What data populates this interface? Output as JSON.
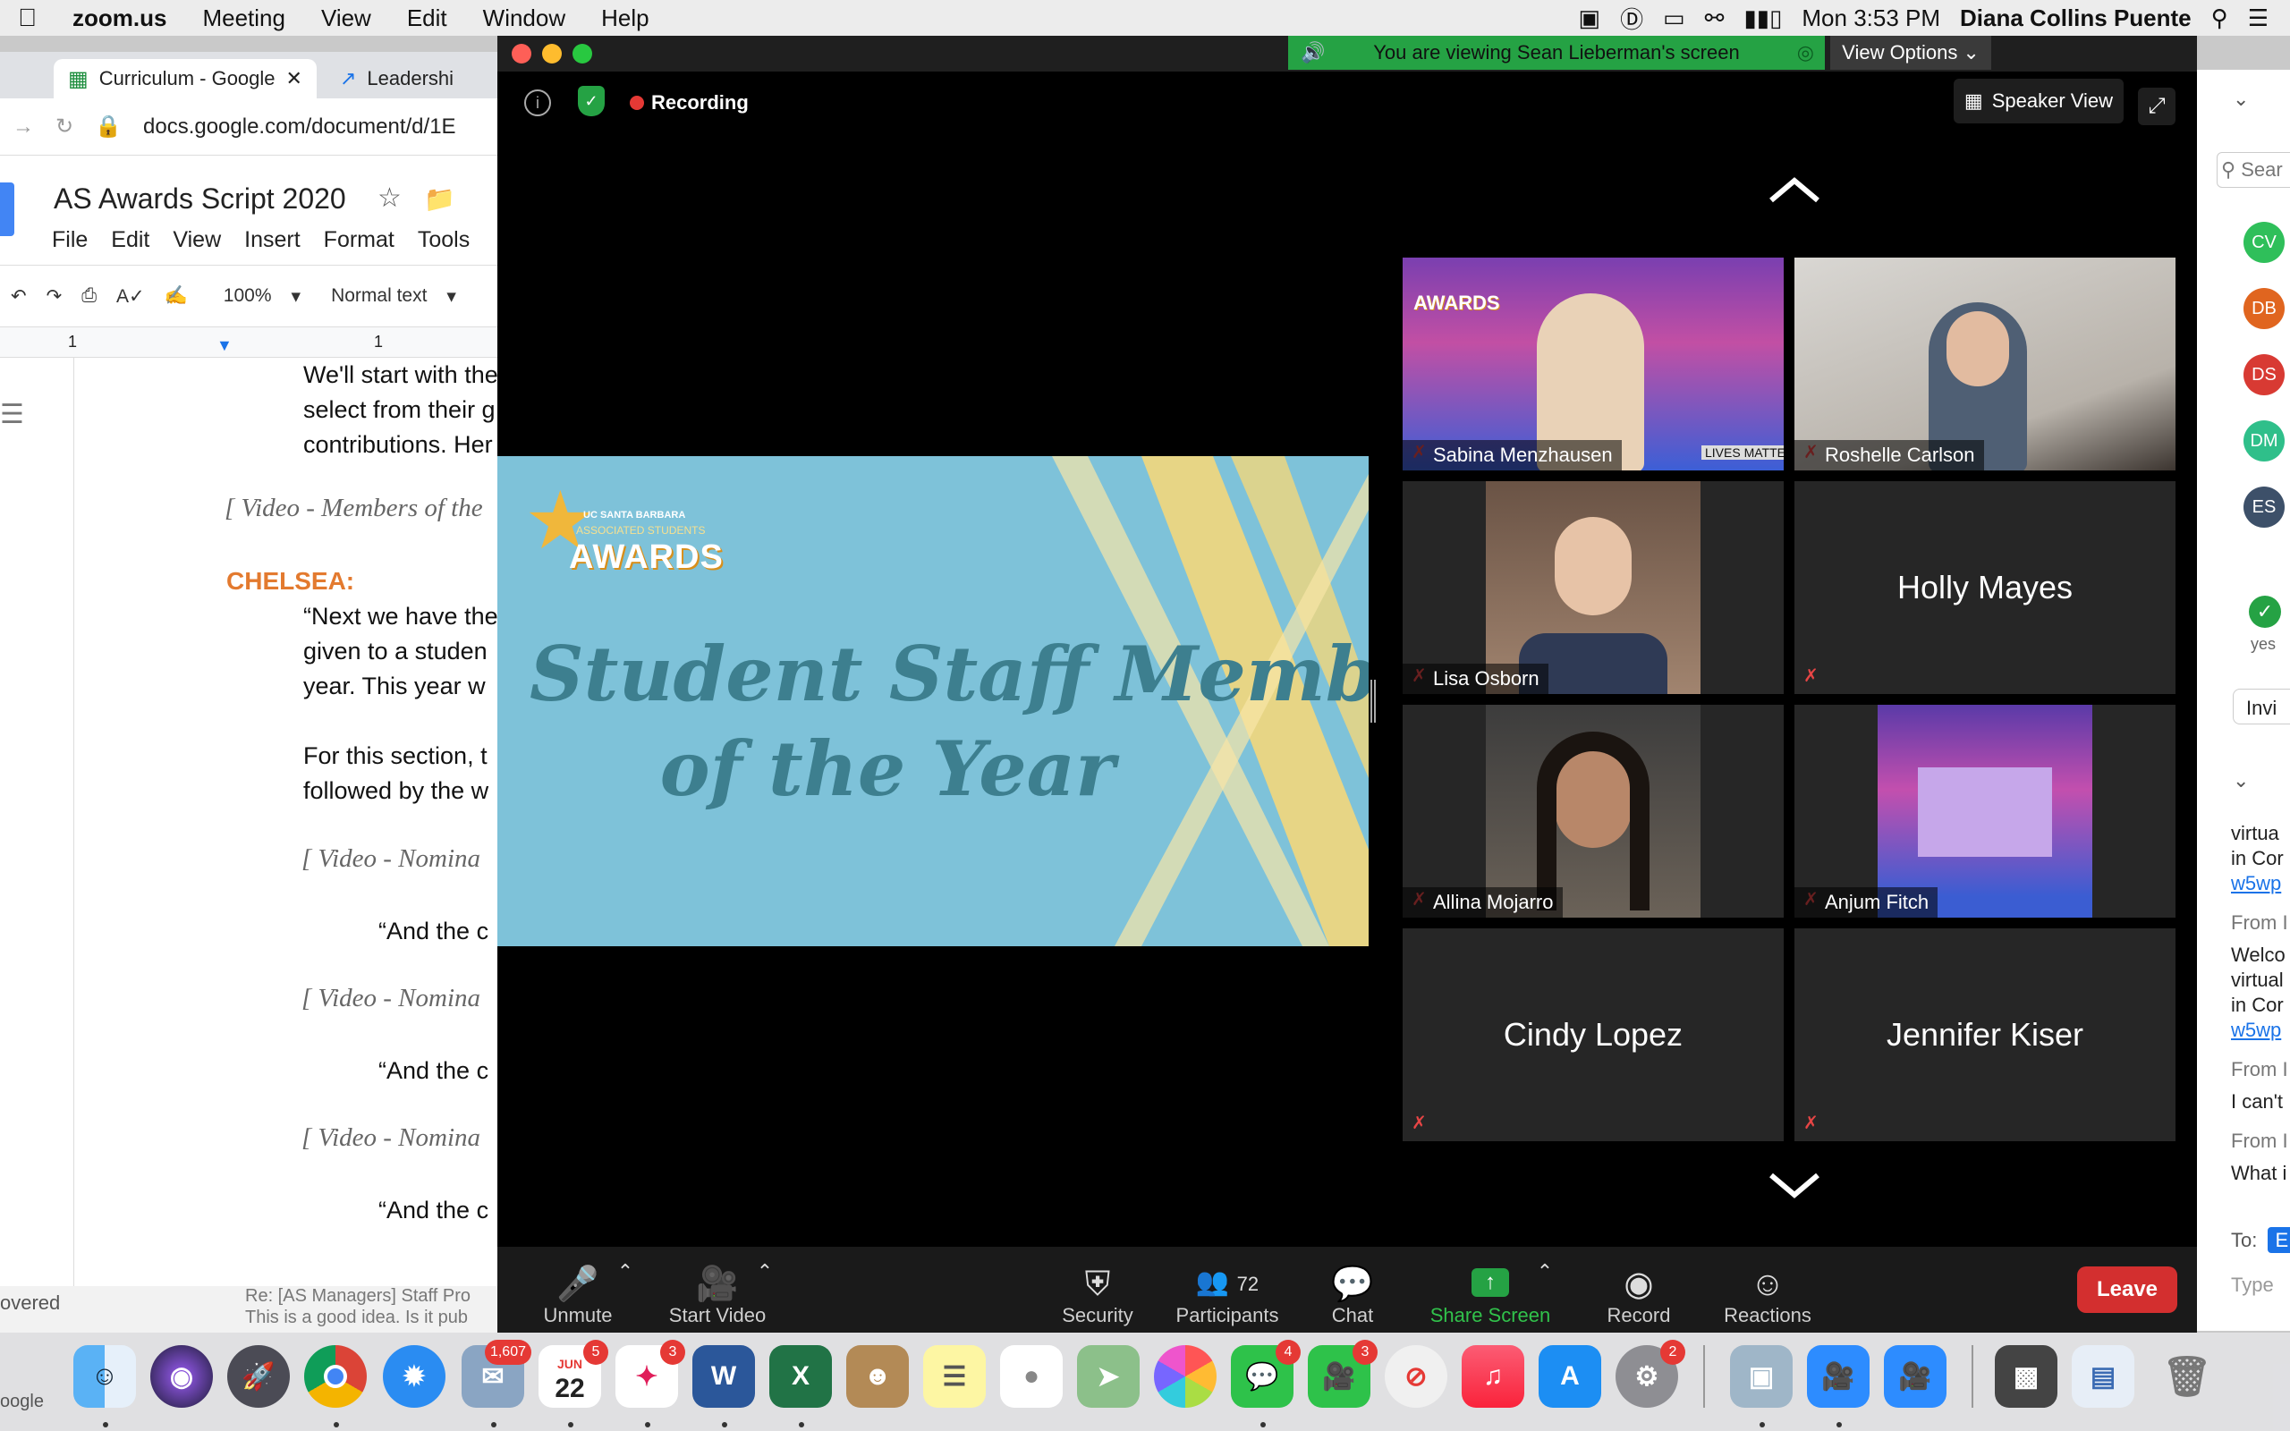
{
  "menubar": {
    "apple": "",
    "app": "zoom.us",
    "items": [
      "Meeting",
      "View",
      "Edit",
      "Window",
      "Help"
    ],
    "clock": "Mon 3:53 PM",
    "user": "Diana Collins Puente"
  },
  "browser": {
    "tabs": [
      "Curriculum - Google",
      "Leadershi"
    ],
    "url": "docs.google.com/document/d/1E"
  },
  "gdocs": {
    "title": "AS Awards Script 2020",
    "menu": [
      "File",
      "Edit",
      "View",
      "Insert",
      "Format",
      "Tools"
    ],
    "zoom": "100%",
    "style": "Normal text",
    "ruler_left": "1",
    "ruler_mid": "1",
    "lines": {
      "l1": "We'll start with the",
      "l2": "select from their g",
      "l3": "contributions. Her",
      "video1": "[ Video - Members of the",
      "speaker": "CHELSEA:",
      "l4": "“Next we have the",
      "l5": "given to a studen",
      "l6": "year. This year w",
      "l7": "For this section, t",
      "l8": "followed by the w",
      "video2": "[ Video - Nomina",
      "q1": "“And the c",
      "video3": "[ Video - Nomina",
      "q2": "“And the c",
      "video4": "[ Video - Nomina",
      "q3": "“And the c"
    },
    "email_snippet_1": "Re: [AS Managers] Staff Pro",
    "email_snippet_2": "This is a good idea. Is it pub",
    "left_edge_1": "overed",
    "left_edge_2": "oogle"
  },
  "zoom": {
    "viewing_banner": "You are viewing Sean Lieberman's screen",
    "view_options": "View Options",
    "recording": "Recording",
    "speaker_view": "Speaker View",
    "shared_slide": {
      "logo_small": "UC SANTA BARBARA",
      "logo_sub": "ASSOCIATED STUDENTS",
      "logo_main": "AWARDS",
      "title_line1": "Student Staff Member",
      "title_line2": "of the Year"
    },
    "participants": [
      {
        "name": "Sabina Menzhausen",
        "video": true
      },
      {
        "name": "Roshelle Carlson",
        "video": true
      },
      {
        "name": "Lisa Osborn",
        "video": true
      },
      {
        "name": "Holly Mayes",
        "video": false
      },
      {
        "name": "Allina Mojarro",
        "video": true
      },
      {
        "name": "Anjum Fitch",
        "video": true
      },
      {
        "name": "Cindy Lopez",
        "video": false
      },
      {
        "name": "Jennifer Kiser",
        "video": false
      }
    ],
    "tile_text_sabina_bg": "AWARDS",
    "tile_text_sabina_tag": "LIVES MATTER",
    "toolbar": {
      "unmute": "Unmute",
      "start_video": "Start Video",
      "security": "Security",
      "participants": "Participants",
      "participants_count": "72",
      "chat": "Chat",
      "share_screen": "Share Screen",
      "record": "Record",
      "reactions": "Reactions",
      "leave": "Leave"
    }
  },
  "side_panel": {
    "search": "Sear",
    "avatars": [
      {
        "initials": "CV",
        "color": "#2fbf5a"
      },
      {
        "initials": "DB",
        "color": "#e0651f"
      },
      {
        "initials": "DS",
        "color": "#d83a33"
      },
      {
        "initials": "DM",
        "color": "#2fbf8a"
      },
      {
        "initials": "ES",
        "color": "#3d5069"
      }
    ],
    "yes": "yes",
    "invite": "Invi",
    "chat": {
      "c1": "virtua",
      "c2": "in Cor",
      "c3": "w5wp",
      "from1": "From I",
      "c4": "Welco",
      "c5": "virtual",
      "c6": "in Cor",
      "c7": "w5wp",
      "from2": "From I",
      "c8": "I can't",
      "from3": "From I",
      "c9": "What i",
      "to": "To:",
      "to_val": "E",
      "type": "Type"
    }
  },
  "dock": {
    "badges": {
      "mail": "1,607",
      "calendar": "5",
      "cal_month": "JUN",
      "cal_day": "22",
      "slack": "3",
      "messages": "4",
      "facetime": "3",
      "settings": "2"
    }
  }
}
